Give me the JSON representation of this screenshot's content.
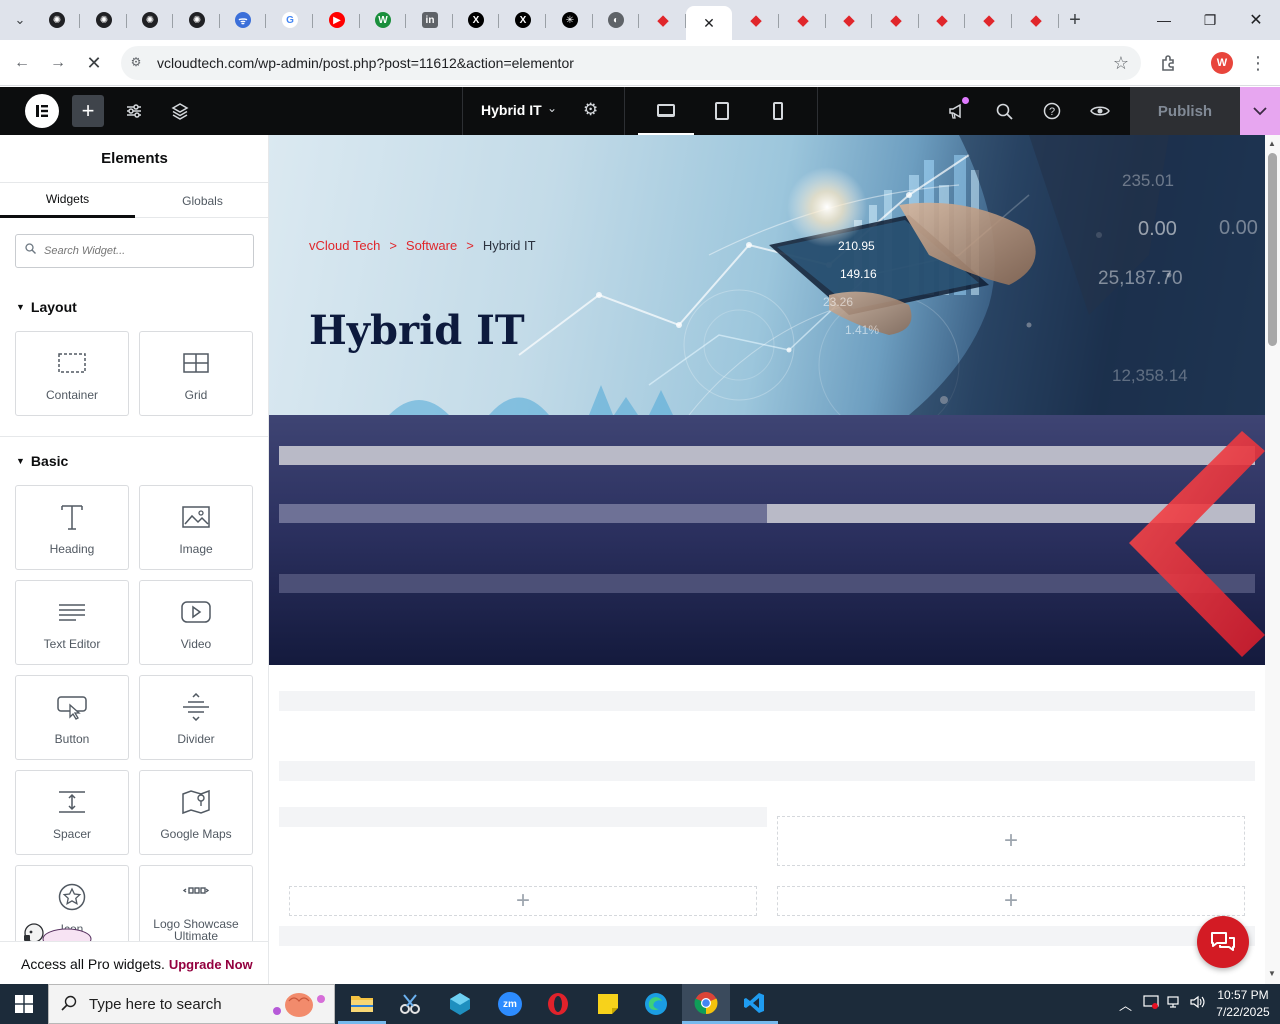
{
  "browser": {
    "tabs": [
      {
        "icon": "openai-icon",
        "color": "#202124"
      },
      {
        "icon": "openai-icon",
        "color": "#202124"
      },
      {
        "icon": "openai-icon",
        "color": "#202124"
      },
      {
        "icon": "openai-icon",
        "color": "#202124"
      },
      {
        "icon": "copilot-icon",
        "color": "#3b6fd9"
      },
      {
        "icon": "google-icon",
        "color": "#ffffff"
      },
      {
        "icon": "youtube-icon",
        "color": "#ff0000"
      },
      {
        "icon": "w-icon",
        "color": "#1a8f3c"
      },
      {
        "icon": "linkedin-icon",
        "color": "#5f6368"
      },
      {
        "icon": "x-icon",
        "color": "#000000"
      },
      {
        "icon": "x-icon",
        "color": "#000000"
      },
      {
        "icon": "perplexity-icon",
        "color": "#000000"
      },
      {
        "icon": "globe-icon",
        "color": "#5f6368"
      },
      {
        "icon": "elementor-tab-icon",
        "color": "#e0262b"
      },
      {
        "icon": "active-tab",
        "color": "#ffffff"
      },
      {
        "icon": "elementor-tab-icon",
        "color": "#e0262b"
      },
      {
        "icon": "elementor-tab-icon",
        "color": "#e0262b"
      },
      {
        "icon": "elementor-tab-icon",
        "color": "#e0262b"
      },
      {
        "icon": "elementor-tab-icon",
        "color": "#e0262b"
      },
      {
        "icon": "elementor-tab-icon",
        "color": "#e0262b"
      },
      {
        "icon": "elementor-tab-icon",
        "color": "#e0262b"
      },
      {
        "icon": "elementor-tab-icon",
        "color": "#e0262b"
      }
    ],
    "active_tab_close": "✕",
    "new_tab": "+",
    "url": "vcloudtech.com/wp-admin/post.php?post=11612&action=elementor",
    "profile_initial": "W"
  },
  "topbar": {
    "page_name": "Hybrid IT",
    "publish_label": "Publish"
  },
  "panel": {
    "title": "Elements",
    "tabs": [
      "Widgets",
      "Globals"
    ],
    "search_placeholder": "Search Widget...",
    "categories": {
      "layout": "Layout",
      "basic": "Basic"
    },
    "layout_widgets": [
      {
        "label": "Container",
        "icon": "container-icon"
      },
      {
        "label": "Grid",
        "icon": "grid-icon"
      }
    ],
    "basic_widgets": [
      {
        "label": "Heading",
        "icon": "heading-icon"
      },
      {
        "label": "Image",
        "icon": "image-icon"
      },
      {
        "label": "Text Editor",
        "icon": "text-editor-icon"
      },
      {
        "label": "Video",
        "icon": "video-icon"
      },
      {
        "label": "Button",
        "icon": "button-icon"
      },
      {
        "label": "Divider",
        "icon": "divider-icon"
      },
      {
        "label": "Spacer",
        "icon": "spacer-icon"
      },
      {
        "label": "Google Maps",
        "icon": "map-icon"
      },
      {
        "label": "Icon",
        "icon": "star-icon"
      },
      {
        "label": "Logo Showcase Ultimate",
        "icon": "logo-showcase-icon"
      }
    ],
    "footer_text": "Access all Pro widgets.",
    "footer_link": "Upgrade Now"
  },
  "hero": {
    "breadcrumb": [
      "vCloud Tech",
      "Software",
      "Hybrid IT"
    ],
    "breadcrumb_separator": ">",
    "title": "Hybrid IT",
    "stats": [
      "210.95",
      "149.16",
      "23.26",
      "1.41%",
      "0.00",
      "25,187.70",
      "12,358.14",
      "0.00",
      "235.01"
    ],
    "accent_color": "#e0262b"
  },
  "canvas": {
    "add_symbol": "+"
  },
  "taskbar": {
    "search_placeholder": "Type here to search",
    "time": "10:57 PM",
    "date": "7/22/2025"
  }
}
